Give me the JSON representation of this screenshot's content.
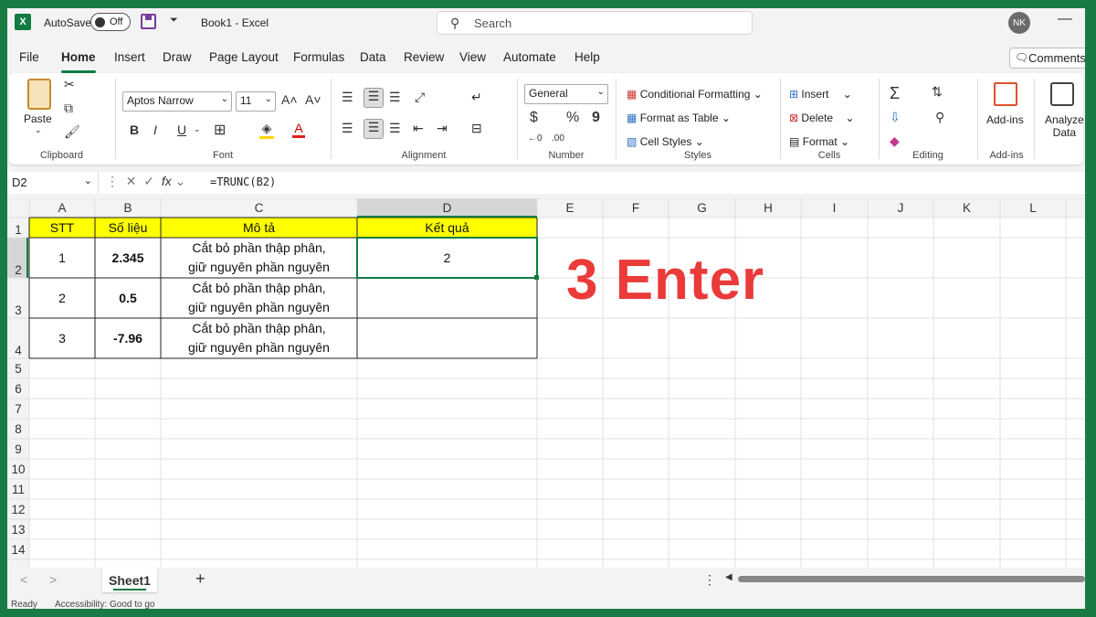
{
  "titlebar": {
    "logo": "X",
    "autosave_label": "AutoSave",
    "autosave_state": "Off",
    "doc_title": "Book1  -  Excel",
    "search_placeholder": "Search",
    "avatar": "NK",
    "minimize": "—"
  },
  "tabs": [
    "File",
    "Home",
    "Insert",
    "Draw",
    "Page Layout",
    "Formulas",
    "Data",
    "Review",
    "View",
    "Automate",
    "Help"
  ],
  "active_tab": "Home",
  "comments_label": "Comments",
  "ribbon": {
    "clipboard": {
      "paste": "Paste",
      "label": "Clipboard"
    },
    "font": {
      "name": "Aptos Narrow",
      "size": "11",
      "bold": "B",
      "italic": "I",
      "underline": "U",
      "grow": "A˄",
      "shrink": "A˅",
      "font_color": "A",
      "label": "Font"
    },
    "alignment": {
      "label": "Alignment"
    },
    "number": {
      "format": "General",
      "currency": "$",
      "percent": "%",
      "comma": "9",
      "label": "Number"
    },
    "styles": {
      "conditional": "Conditional Formatting",
      "format_table": "Format as Table",
      "cell_styles": "Cell Styles",
      "label": "Styles"
    },
    "cells": {
      "insert": "Insert",
      "delete": "Delete",
      "format": "Format",
      "label": "Cells"
    },
    "editing": {
      "label": "Editing"
    },
    "addins": {
      "addins": "Add-ins",
      "label": "Add-ins"
    },
    "analyze": {
      "line1": "Analyze",
      "line2": "Data"
    }
  },
  "formula_bar": {
    "name_box": "D2",
    "fx": "fx",
    "formula": "=TRUNC(B2)"
  },
  "columns": [
    "A",
    "B",
    "C",
    "D",
    "E",
    "F",
    "G",
    "H",
    "I",
    "J",
    "K",
    "L"
  ],
  "rows": [
    "1",
    "2",
    "3",
    "4",
    "5",
    "6",
    "7",
    "8",
    "9",
    "10",
    "11",
    "12",
    "13",
    "14"
  ],
  "table": {
    "headers": [
      "STT",
      "Số liệu",
      "Mô tả",
      "Kết quả"
    ],
    "rows": [
      {
        "stt": "1",
        "value": "2.345",
        "desc1": "Cắt bỏ phần thập phân,",
        "desc2": "giữ nguyên phần nguyên",
        "result": "2"
      },
      {
        "stt": "2",
        "value": "0.5",
        "desc1": "Cắt bỏ phần thập phân,",
        "desc2": "giữ nguyên phần nguyên",
        "result": ""
      },
      {
        "stt": "3",
        "value": "-7.96",
        "desc1": "Cắt bỏ phần thập phân,",
        "desc2": "giữ nguyên phần nguyên",
        "result": ""
      }
    ]
  },
  "overlay": "3 Enter",
  "sheet": {
    "tab": "Sheet1",
    "add": "+",
    "prev": "<",
    "next": ">",
    "more": "⋮"
  },
  "status": {
    "ready": "Ready",
    "accessibility": "Accessibility: Good to go"
  },
  "colors": {
    "excel_green": "#107c41",
    "header_yellow": "#ffff00",
    "overlay_red": "#ea3a3a",
    "frame": "#1a7a43"
  }
}
